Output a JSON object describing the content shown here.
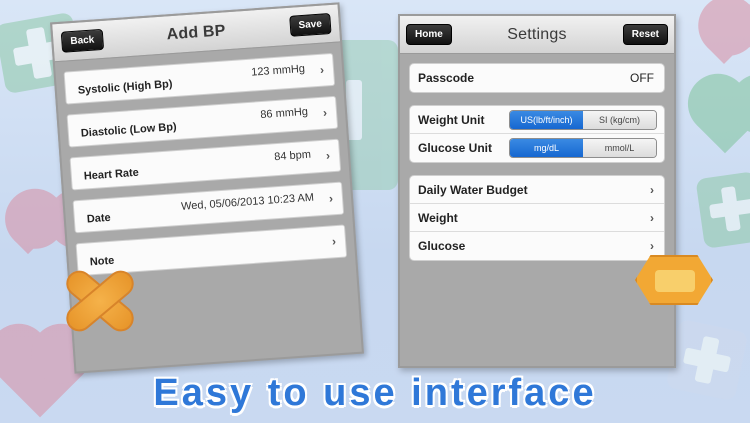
{
  "add_bp": {
    "title": "Add BP",
    "back_label": "Back",
    "save_label": "Save",
    "rows": [
      {
        "label": "Systolic (High Bp)",
        "value": "123 mmHg"
      },
      {
        "label": "Diastolic (Low Bp)",
        "value": "86 mmHg"
      },
      {
        "label": "Heart Rate",
        "value": "84 bpm"
      },
      {
        "label": "Date",
        "value": "Wed, 05/06/2013 10:23 AM"
      },
      {
        "label": "Note",
        "value": ""
      }
    ]
  },
  "settings": {
    "title": "Settings",
    "home_label": "Home",
    "reset_label": "Reset",
    "passcode": {
      "label": "Passcode",
      "value": "OFF"
    },
    "weight_unit": {
      "label": "Weight Unit",
      "options": [
        "US(lb/ft/inch)",
        "SI (kg/cm)"
      ],
      "selected": 0
    },
    "glucose_unit": {
      "label": "Glucose Unit",
      "options": [
        "mg/dL",
        "mmol/L"
      ],
      "selected": 0
    },
    "menu": [
      "Daily Water Budget",
      "Weight",
      "Glucose"
    ]
  },
  "slogan": "Easy to use interface",
  "colors": {
    "accent": "#2f78d8",
    "segment_on": "#1667d1",
    "bandage": "#f2a834"
  }
}
